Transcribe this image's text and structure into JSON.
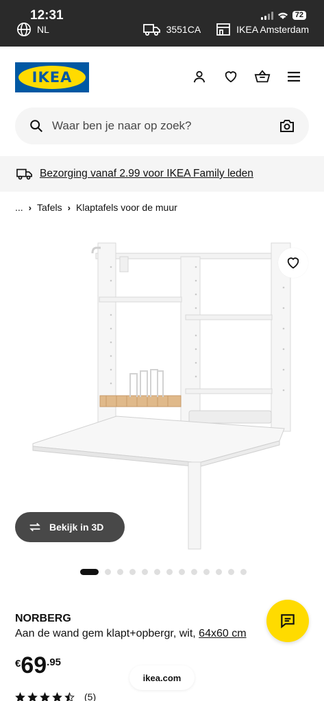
{
  "status_bar": {
    "time": "12:31",
    "battery": "72",
    "region": "NL",
    "postcode": "3551CA",
    "store": "IKEA Amsterdam"
  },
  "header": {
    "logo_text": "IKEA",
    "icons": [
      "user-icon",
      "heart-icon",
      "basket-icon",
      "menu-icon"
    ]
  },
  "search": {
    "placeholder": "Waar ben je naar op zoek?"
  },
  "promo": {
    "text": "Bezorging vanaf 2.99 voor IKEA Family leden"
  },
  "breadcrumb": {
    "items": [
      "...",
      "Tafels",
      "Klaptafels voor de muur"
    ]
  },
  "gallery": {
    "view_3d_label": "Bekijk in 3D",
    "total_images": 13,
    "active_index": 0
  },
  "product": {
    "name": "NORBERG",
    "description": "Aan de wand gem klapt+opbergr, wit, ",
    "dimensions": "64x60 cm",
    "currency": "€",
    "price_int": "69",
    "price_dec": ".95",
    "rating": 4.5,
    "review_count": "(5)"
  },
  "browser": {
    "url": "ikea.com"
  },
  "colors": {
    "ikea_blue": "#0058a3",
    "ikea_yellow": "#ffdb00",
    "dark_button": "#484848",
    "status_bar_bg": "#2a2a2a"
  }
}
